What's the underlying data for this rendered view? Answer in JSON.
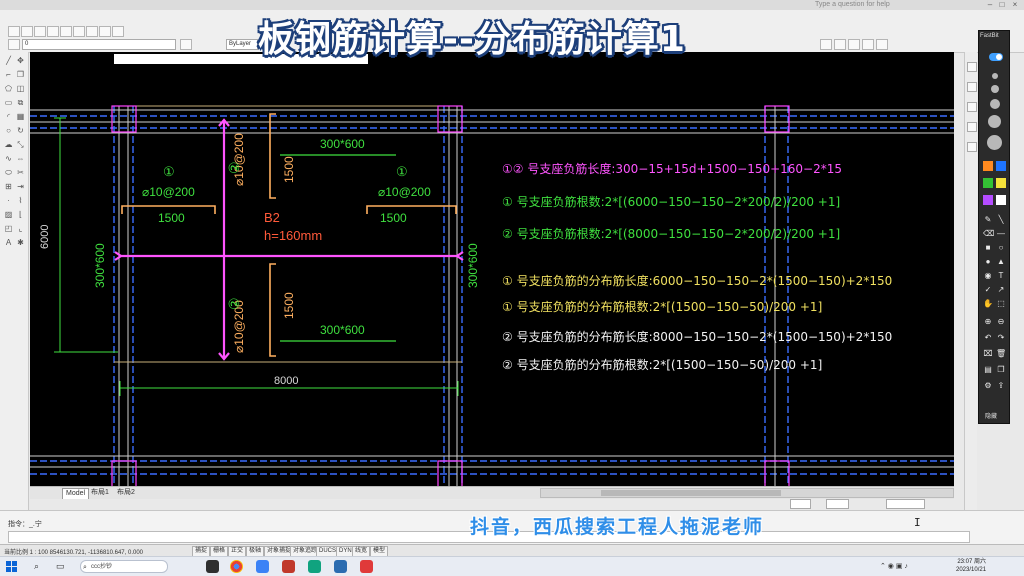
{
  "video_title": "板钢筋计算--分布筋计算1",
  "watermark": "抖音，西瓜搜索工程人拖泥老师",
  "window": {
    "help_hint": "Type a question for help"
  },
  "ribbon": {
    "layer_combo": "0",
    "style_combo": "ByLayer"
  },
  "drawing": {
    "beam_top_label": "300*600",
    "beam_bottom_label": "300*600",
    "beam_left_label": "300*600",
    "beam_right_label": "300*600",
    "slab_label": "B2",
    "slab_thickness": "h=160mm",
    "dim_height": "6000",
    "dim_width": "8000",
    "rebar1_left_mark": "①",
    "rebar1_left_spec": "⌀10@200",
    "rebar1_left_len": "1500",
    "rebar1_right_mark": "①",
    "rebar1_right_spec": "⌀10@200",
    "rebar1_right_len": "1500",
    "rebar2_top_mark": "②",
    "rebar2_top_spec": "⌀10@200",
    "rebar2_top_len": "1500",
    "rebar2_bottom_mark": "②",
    "rebar2_bottom_spec": "⌀10@200",
    "rebar2_bottom_len": "1500"
  },
  "formulas": [
    {
      "text": "①② 号支座负筋长度:300−15+15d+1500−150+160−2*15",
      "color": "#ff55ff"
    },
    {
      "text": "① 号支座负筋根数:2*[(6000−150−150−2*200/2)/200 +1]",
      "color": "#3fe03f"
    },
    {
      "text": "② 号支座负筋根数:2*[(8000−150−150−2*200/2)/200 +1]",
      "color": "#3fe03f"
    },
    {
      "text": "① 号支座负筋的分布筋长度:6000−150−150−2*(1500−150)+2*150",
      "color": "#f0e060"
    },
    {
      "text": "① 号支座负筋的分布筋根数:2*[(1500−150−50)/200 +1]",
      "color": "#f0e060"
    },
    {
      "text": "② 号支座负筋的分布筋长度:8000−150−150−2*(1500−150)+2*150",
      "color": "#f2f2f2"
    },
    {
      "text": "② 号支座负筋的分布筋根数:2*[(1500−150−50)/200 +1]",
      "color": "#f2f2f2"
    }
  ],
  "tabs": [
    "Model",
    "布局1",
    "布局2"
  ],
  "command": {
    "history": "指令：_.宁",
    "prompt": ""
  },
  "status": {
    "coords": "当前比例 1 : 100  8546130.721, -1136810.647, 0.000",
    "modes": [
      "捕捉",
      "栅格",
      "正交",
      "极轴",
      "对象捕捉",
      "对象追踪",
      "DUCS",
      "DYN",
      "线宽",
      "模型"
    ]
  },
  "right_panel": {
    "title": "FastBit",
    "footer": "隐藏"
  },
  "taskbar": {
    "search_placeholder": "ccc抄钞",
    "time": "23:07 周六",
    "date": "2023/10/21"
  },
  "colors": {
    "canvas_bg": "#000000",
    "beam_line": "#d8d8d8",
    "axis_blue": "#3b6cff",
    "column_magenta": "#ff44ff",
    "rebar_magenta": "#ff55ff",
    "dim_green": "#3fe03f",
    "rebar_orange": "#ffb060",
    "slab_label_red": "#ff5a3a"
  }
}
